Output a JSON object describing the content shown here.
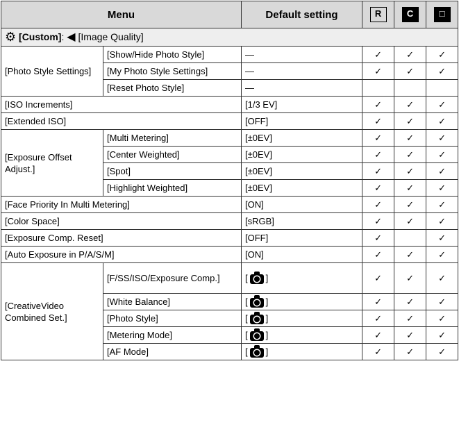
{
  "header": {
    "menu": "Menu",
    "default_setting": "Default setting",
    "icon1": "R",
    "icon2": "C",
    "icon3": "□"
  },
  "section": {
    "custom": "[Custom]",
    "sep": ":",
    "image_quality": "[Image Quality]"
  },
  "check": "✓",
  "rows": {
    "photo_style": {
      "group": "[Photo Style Settings]",
      "show_hide": "[Show/Hide Photo Style]",
      "show_hide_default": "—",
      "my_photo": "[My Photo Style Settings]",
      "my_photo_default": "—",
      "reset": "[Reset Photo Style]",
      "reset_default": "—"
    },
    "iso_inc": {
      "label": "[ISO Increments]",
      "default": "[1/3 EV]"
    },
    "ext_iso": {
      "label": "[Extended ISO]",
      "default": "[OFF]"
    },
    "exposure_offset": {
      "group": "[Exposure Offset Adjust.]",
      "multi": "[Multi Metering]",
      "multi_default": "[±0EV]",
      "center": "[Center Weighted]",
      "center_default": "[±0EV]",
      "spot": "[Spot]",
      "spot_default": "[±0EV]",
      "highlight": "[Highlight Weighted]",
      "highlight_default": "[±0EV]"
    },
    "face_priority": {
      "label": "[Face Priority In Multi Metering]",
      "default": "[ON]"
    },
    "color_space": {
      "label": "[Color Space]",
      "default": "[sRGB]"
    },
    "exp_comp_reset": {
      "label": "[Exposure Comp. Reset]",
      "default": "[OFF]"
    },
    "auto_exposure": {
      "label": "[Auto Exposure in P/A/S/M]",
      "default": "[ON]"
    },
    "creative_video": {
      "group": "[CreativeVideo Combined Set.]",
      "f_ss": "[F/SS/ISO/Exposure Comp.]",
      "wb": "[White Balance]",
      "photo_style": "[Photo Style]",
      "metering": "[Metering Mode]",
      "af_mode": "[AF Mode]",
      "bracket_open": "[",
      "bracket_close": "]"
    }
  }
}
